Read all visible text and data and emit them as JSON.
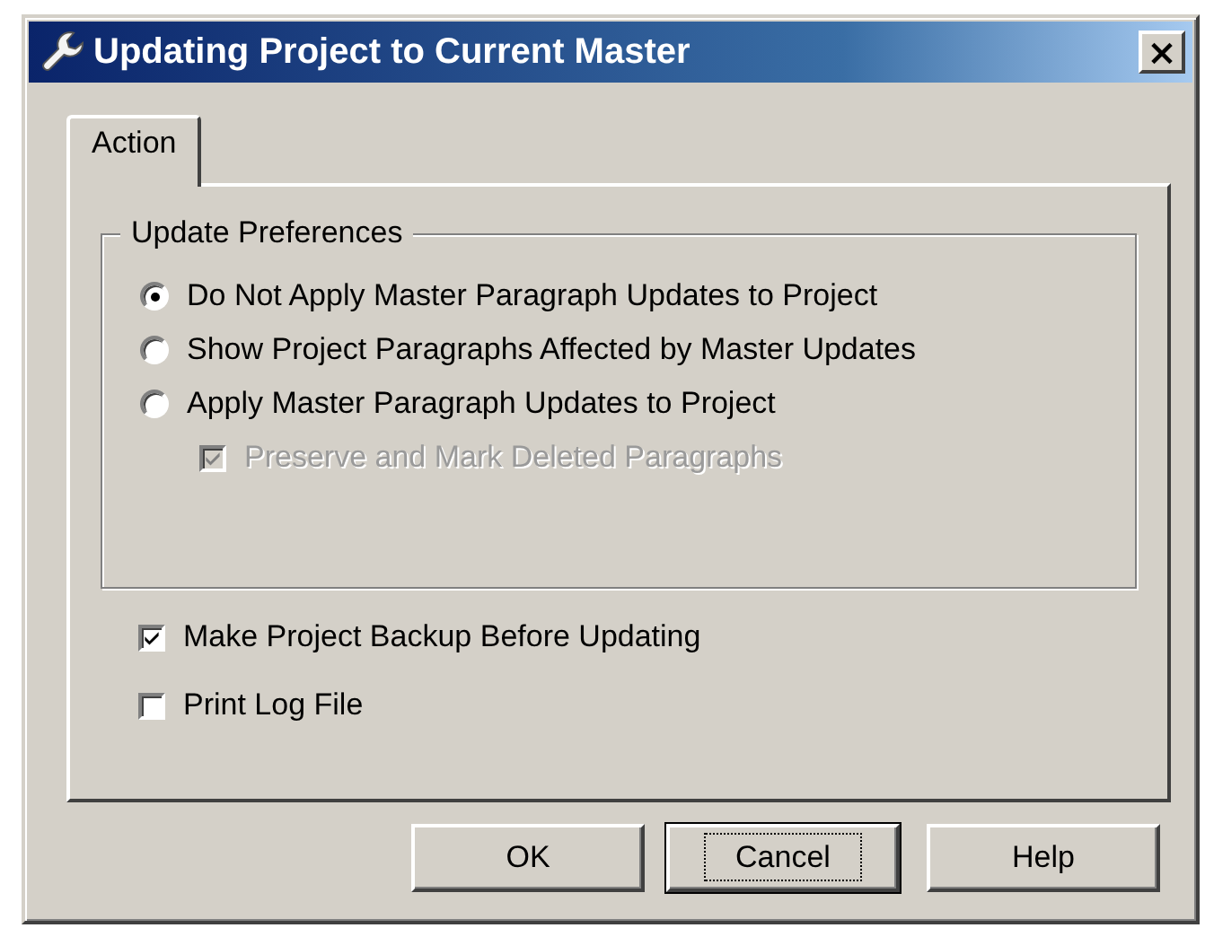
{
  "window": {
    "title": "Updating Project to Current Master",
    "close_label": "×"
  },
  "tabs": [
    {
      "label": "Action",
      "selected": true
    }
  ],
  "update_preferences": {
    "title": "Update Preferences",
    "options": [
      {
        "label": "Do Not Apply Master Paragraph Updates to Project",
        "selected": true
      },
      {
        "label": "Show Project Paragraphs Affected by Master Updates",
        "selected": false
      },
      {
        "label": "Apply Master Paragraph Updates to Project",
        "selected": false
      }
    ],
    "sub_option": {
      "label": "Preserve and Mark Deleted Paragraphs",
      "checked": true,
      "disabled": true
    }
  },
  "checkboxes": [
    {
      "label": "Make Project Backup Before Updating",
      "checked": true,
      "disabled": false
    },
    {
      "label": "Print Log File",
      "checked": false,
      "disabled": false
    }
  ],
  "buttons": [
    {
      "label": "OK",
      "focused": false
    },
    {
      "label": "Cancel",
      "focused": true
    },
    {
      "label": "Help",
      "focused": false
    }
  ]
}
